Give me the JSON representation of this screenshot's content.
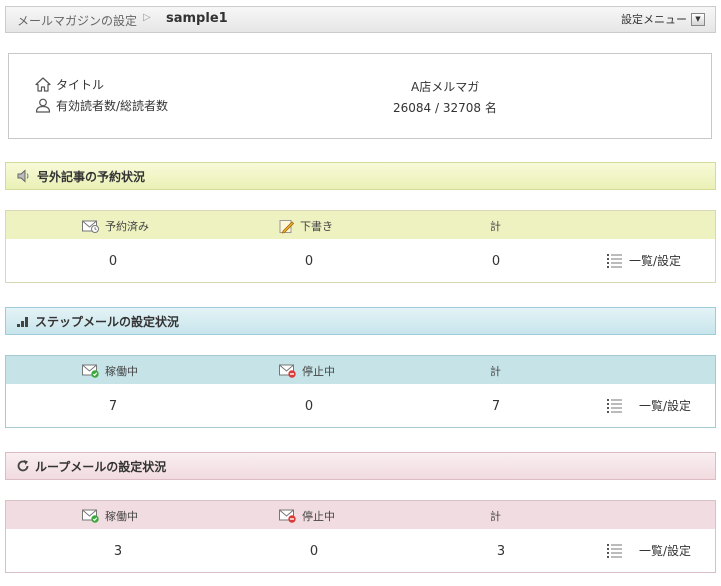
{
  "breadcrumb": {
    "parent": "メールマガジンの設定",
    "separator": "▷",
    "current": "sample1"
  },
  "settings_menu": {
    "label": "設定メニュー",
    "arrow": "▼"
  },
  "info": {
    "title_label": "タイトル",
    "title_value": "A店メルマガ",
    "readers_label": "有効読者数/総読者数",
    "readers_value": "26084 / 32708 名"
  },
  "sections": {
    "extra": {
      "title": "号外記事の予約状況",
      "columns": [
        "予約済み",
        "下書き",
        "計"
      ],
      "values": [
        "0",
        "0",
        "0"
      ],
      "list_label": "一覧/設定"
    },
    "step": {
      "title": "ステップメールの設定状況",
      "columns": [
        "稼働中",
        "停止中",
        "計"
      ],
      "values": [
        "7",
        "0",
        "7"
      ],
      "list_label": "一覧/設定"
    },
    "loop": {
      "title": "ループメールの設定状況",
      "columns": [
        "稼働中",
        "停止中",
        "計"
      ],
      "values": [
        "3",
        "0",
        "3"
      ],
      "list_label": "一覧/設定"
    }
  },
  "colors": {
    "yellow": "#eef2c0",
    "blue": "#c6e3e7",
    "pink": "#f1dde1",
    "active": "#3aa83a",
    "stopped": "#d93a3a"
  }
}
